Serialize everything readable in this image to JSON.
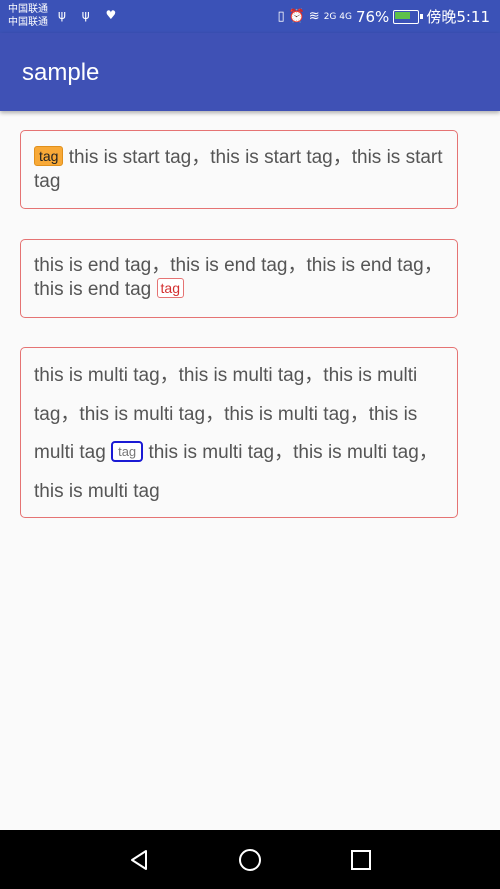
{
  "status_bar": {
    "carrier_line1": "中国联通",
    "carrier_line2": "中国联通",
    "usb_icons": "ψ ψ ♥",
    "signal_labels": "2G 4G",
    "battery_percent": "76%",
    "time": "傍晚5:11"
  },
  "app_bar": {
    "title": "sample"
  },
  "cards": {
    "start": {
      "tag": "tag",
      "text": "this is start tag，this is start tag，this is start tag"
    },
    "end": {
      "text": "this is end tag，this is end tag，this is end tag，this is end tag",
      "tag": "tag"
    },
    "multi": {
      "text_before": "this is multi tag，this is multi tag，this is multi tag，this is multi tag，this is multi tag，this is multi tag",
      "tag": "tag",
      "text_after": "this is multi tag，this is multi tag，this is multi tag"
    }
  },
  "nav_bar": {
    "icons": [
      "back-icon",
      "home-icon",
      "recent-apps-icon"
    ]
  },
  "colors": {
    "app_bar": "#3f51b5",
    "card_border": "#e57373",
    "start_tag_bg": "#f8a937",
    "end_tag_color": "#d32f2f",
    "multi_tag_border": "#1a1ad4"
  }
}
